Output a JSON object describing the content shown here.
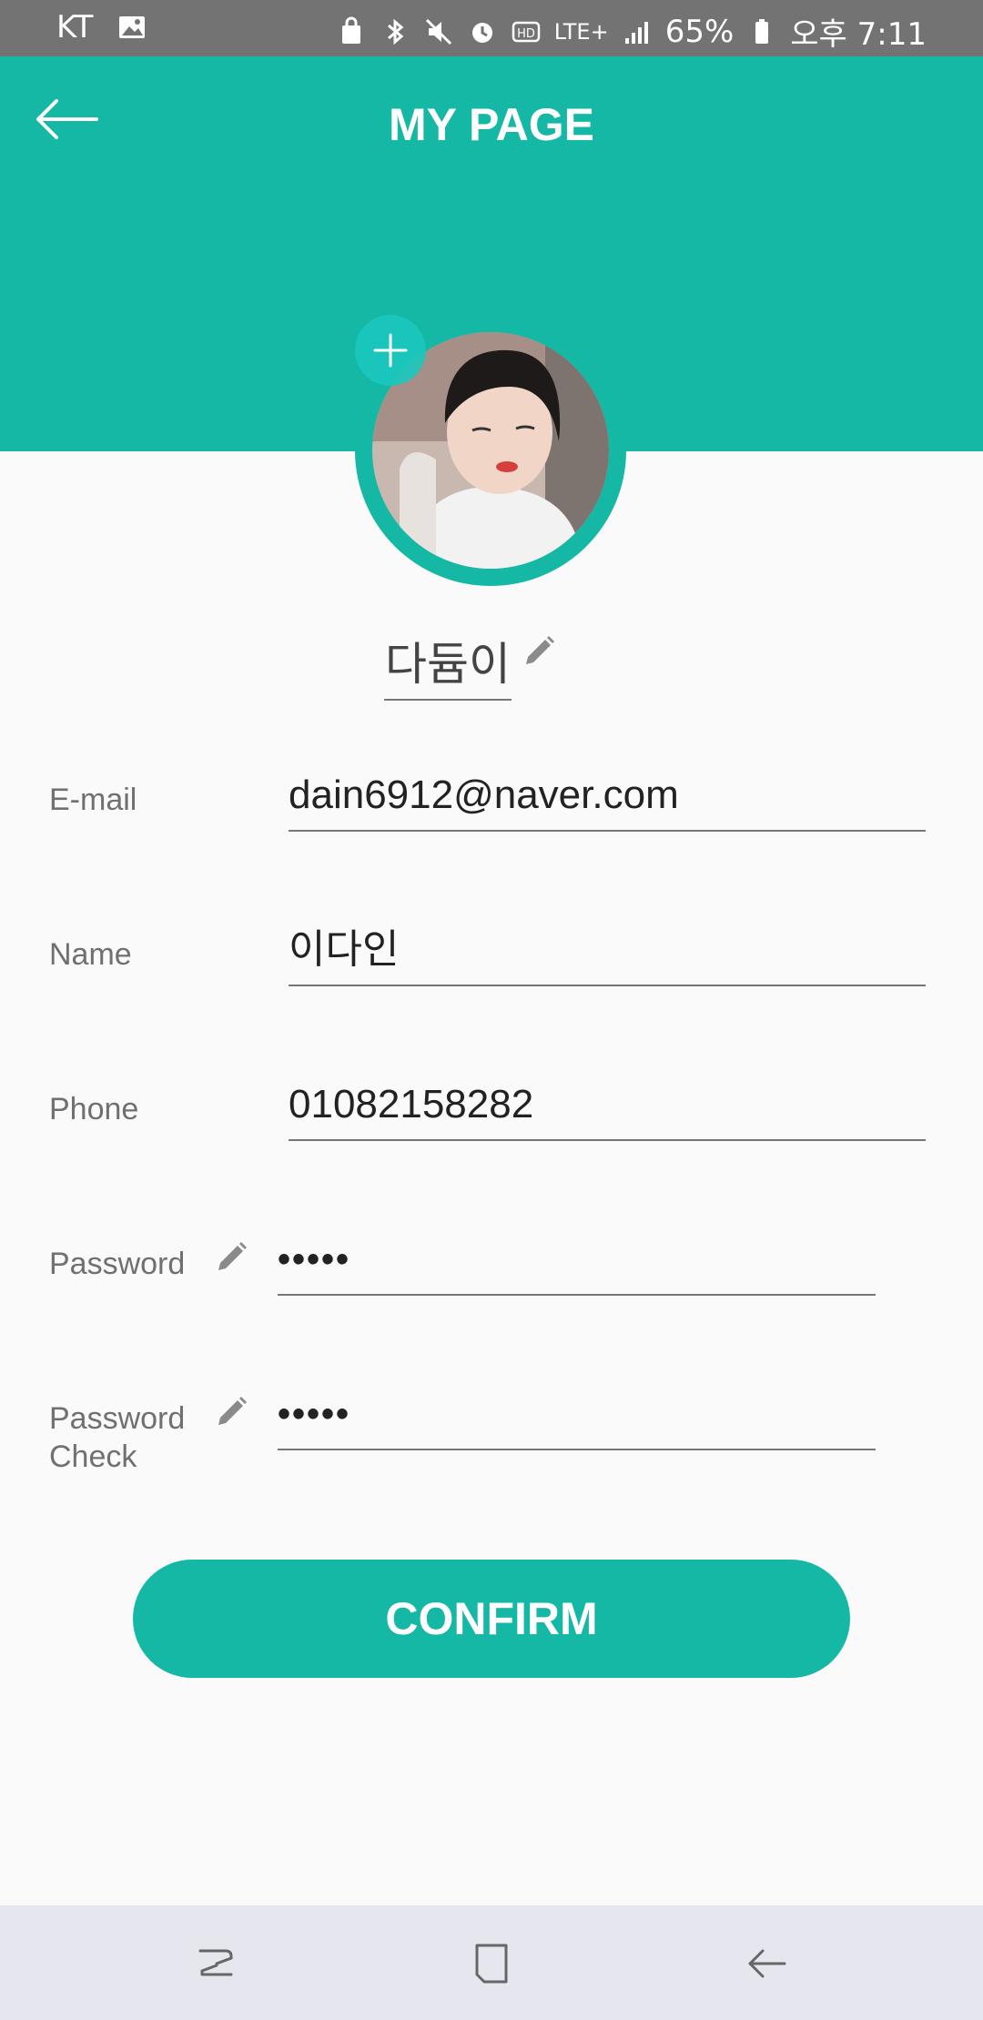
{
  "status_bar": {
    "carrier": "KT",
    "network": "LTE+",
    "battery": "65%",
    "time": "오후 7:11"
  },
  "header": {
    "title": "MY PAGE"
  },
  "profile": {
    "nickname": "다듐이"
  },
  "form": {
    "email": {
      "label": "E-mail",
      "value": "dain6912@naver.com"
    },
    "name": {
      "label": "Name",
      "value": "이다인"
    },
    "phone": {
      "label": "Phone",
      "value": "01082158282"
    },
    "password": {
      "label": "Password",
      "value": "•••••"
    },
    "password_check": {
      "label_line1": "Password",
      "label_line2": "Check",
      "value": "•••••"
    }
  },
  "confirm_label": "CONFIRM",
  "colors": {
    "accent": "#14b8a4",
    "status_bar": "#737373",
    "nav_bar": "#e6e6ef"
  }
}
